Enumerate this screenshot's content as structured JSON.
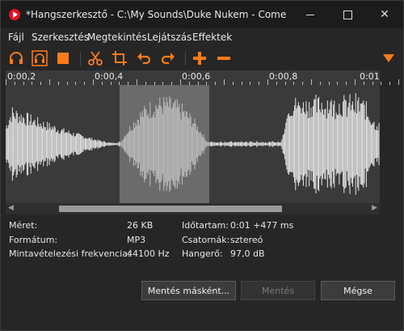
{
  "window": {
    "title": "*Hangszerkesztő - C:\\My Sounds\\Duke Nukem - Come get...",
    "minimize": "—",
    "maximize": "",
    "close": "✕"
  },
  "menu": [
    "Fájl",
    "Szerkesztés",
    "Megtekintés",
    "Lejátszás",
    "Effektek"
  ],
  "toolbar": {
    "icons": [
      "headphones-icon",
      "headphones-selection-icon",
      "stop-icon",
      "scissors-icon",
      "crop-icon",
      "undo-icon",
      "redo-icon",
      "plus-icon",
      "minus-icon",
      "dropdown-arrow-icon"
    ],
    "accent": "#ff7b1a"
  },
  "timeline": {
    "labels": [
      "0:00,2",
      "0:00,4",
      "0:00,6",
      "0:00,8",
      "0:01"
    ]
  },
  "waveform": {
    "selection": {
      "start": "0:00,45",
      "end": "0:00,65"
    },
    "colors": {
      "background": "#3a3a3a",
      "selection": "#6b6b6b",
      "wave": "#e8e8e8",
      "wave_selected": "#bdbdbd"
    }
  },
  "info": {
    "size_label": "Méret:",
    "size_value": "26 KB",
    "format_label": "Formátum:",
    "format_value": "MP3",
    "rate_label": "Mintavételezési frekvencia:",
    "rate_value": "44100 Hz",
    "duration_label": "Időtartam:",
    "duration_value": "0:01 +477 ms",
    "channels_label": "Csatornák:",
    "channels_value": "sztereó",
    "volume_label": "Hangerő:",
    "volume_value": "97,0 dB"
  },
  "buttons": {
    "save_as": "Mentés másként...",
    "save": "Mentés",
    "cancel": "Mégse"
  }
}
